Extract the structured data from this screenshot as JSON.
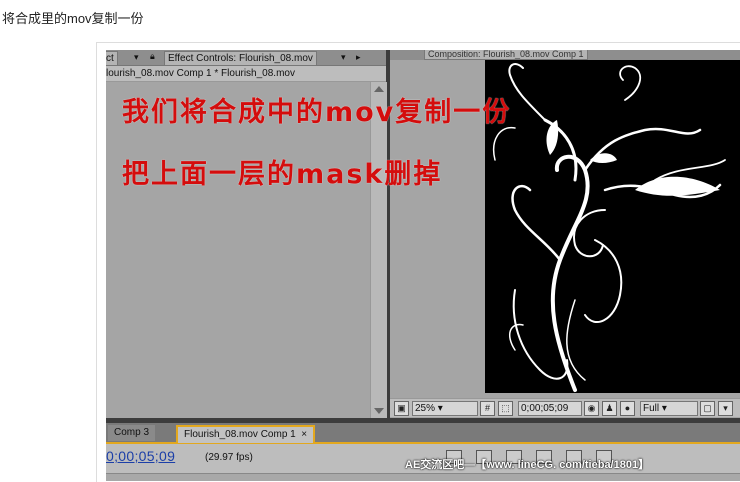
{
  "post_title": "将合成里的mov复制一份",
  "left_panel": {
    "tab_partial": "ct",
    "effect_controls_tab": "Effect Controls: Flourish_08.mov",
    "subtitle": "lourish_08.mov Comp 1 * Flourish_08.mov"
  },
  "comp_viewer": {
    "tab_label": "Composition: Flourish_08.mov Comp 1",
    "magnification": "25%",
    "timecode": "0;00;05;09",
    "resolution": "Full"
  },
  "timeline": {
    "tabs": [
      {
        "label": "Comp 3"
      },
      {
        "label": "Flourish_08.mov Comp 1"
      }
    ],
    "close_symbol": "×",
    "timecode": "0;00;05;09",
    "fps": "(29.97 fps)"
  },
  "watermark": "AE交流区吧—【www. lineCG. com/tieba/1801】",
  "overlay": {
    "line1": "我们将合成中的mov复制一份",
    "line2": "把上面一层的mask删掉"
  },
  "colors": {
    "overlay_red": "#d40d0d",
    "timecode_blue": "#1c3fa8",
    "active_tab_outline": "#e3a81e"
  }
}
